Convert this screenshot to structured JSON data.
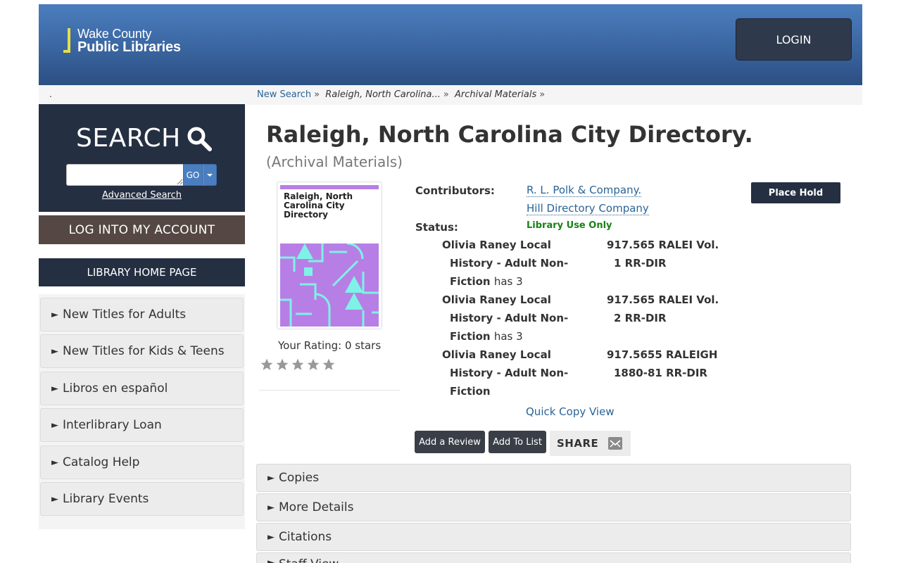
{
  "header": {
    "logo_line1": "Wake County",
    "logo_line2": "Public Libraries",
    "login_label": "LOGIN"
  },
  "breadcrumb": {
    "dot": ".",
    "new_search": "New Search",
    "record": "Raleigh, North Carolina...",
    "format": "Archival Materials",
    "separator": "»"
  },
  "sidebar": {
    "search_title": "SEARCH",
    "search_value": "",
    "go_label": "GO",
    "advanced_search": "Advanced Search",
    "log_into": "LOG INTO MY ACCOUNT",
    "library_home": "LIBRARY HOME PAGE",
    "items": [
      {
        "label": "New Titles for Adults"
      },
      {
        "label": "New Titles for Kids & Teens"
      },
      {
        "label": "Libros en español"
      },
      {
        "label": "Interlibrary Loan"
      },
      {
        "label": "Catalog Help"
      },
      {
        "label": "Library Events"
      }
    ]
  },
  "record": {
    "title": "Raleigh, North Carolina City Directory.",
    "format": "(Archival Materials)",
    "cover_text": "Raleigh, North Carolina City Directory",
    "rating_label": "Your Rating: 0 stars",
    "rating": 0,
    "rating_max": 5,
    "contributors_label": "Contributors:",
    "contributors": [
      "R. L. Polk & Company.",
      "Hill Directory Company"
    ],
    "status_label": "Status:",
    "status_value": "Library Use Only",
    "holdings": [
      {
        "loc1": "Olivia Raney Local",
        "loc2": "History - Adult Non-",
        "loc3": "Fiction",
        "has": "has 3",
        "call1": "917.565 RALEI Vol.",
        "call2": "1 RR-DIR"
      },
      {
        "loc1": "Olivia Raney Local",
        "loc2": "History - Adult Non-",
        "loc3": "Fiction",
        "has": "has 3",
        "call1": "917.565 RALEI Vol.",
        "call2": "2 RR-DIR"
      },
      {
        "loc1": "Olivia Raney Local",
        "loc2": "History - Adult Non-",
        "loc3": "Fiction",
        "has": "",
        "call1": "917.5655 RALEIGH",
        "call2": "1880-81 RR-DIR"
      }
    ],
    "quick_copy": "Quick Copy View",
    "place_hold": "Place Hold",
    "add_review": "Add a Review",
    "add_to_list": "Add To List",
    "share": "SHARE"
  },
  "accordions": [
    {
      "label": "Copies"
    },
    {
      "label": "More Details"
    },
    {
      "label": "Citations"
    },
    {
      "label": "Staff View"
    }
  ],
  "colors": {
    "header_top": "#4b7dbd",
    "header_bottom": "#2c4f83",
    "navy": "#252f42",
    "account_brown": "#554844",
    "link": "#2a6496",
    "status_green": "#178217",
    "cover_purple": "#b77fe6",
    "cover_cyan": "#7ef2e6"
  }
}
